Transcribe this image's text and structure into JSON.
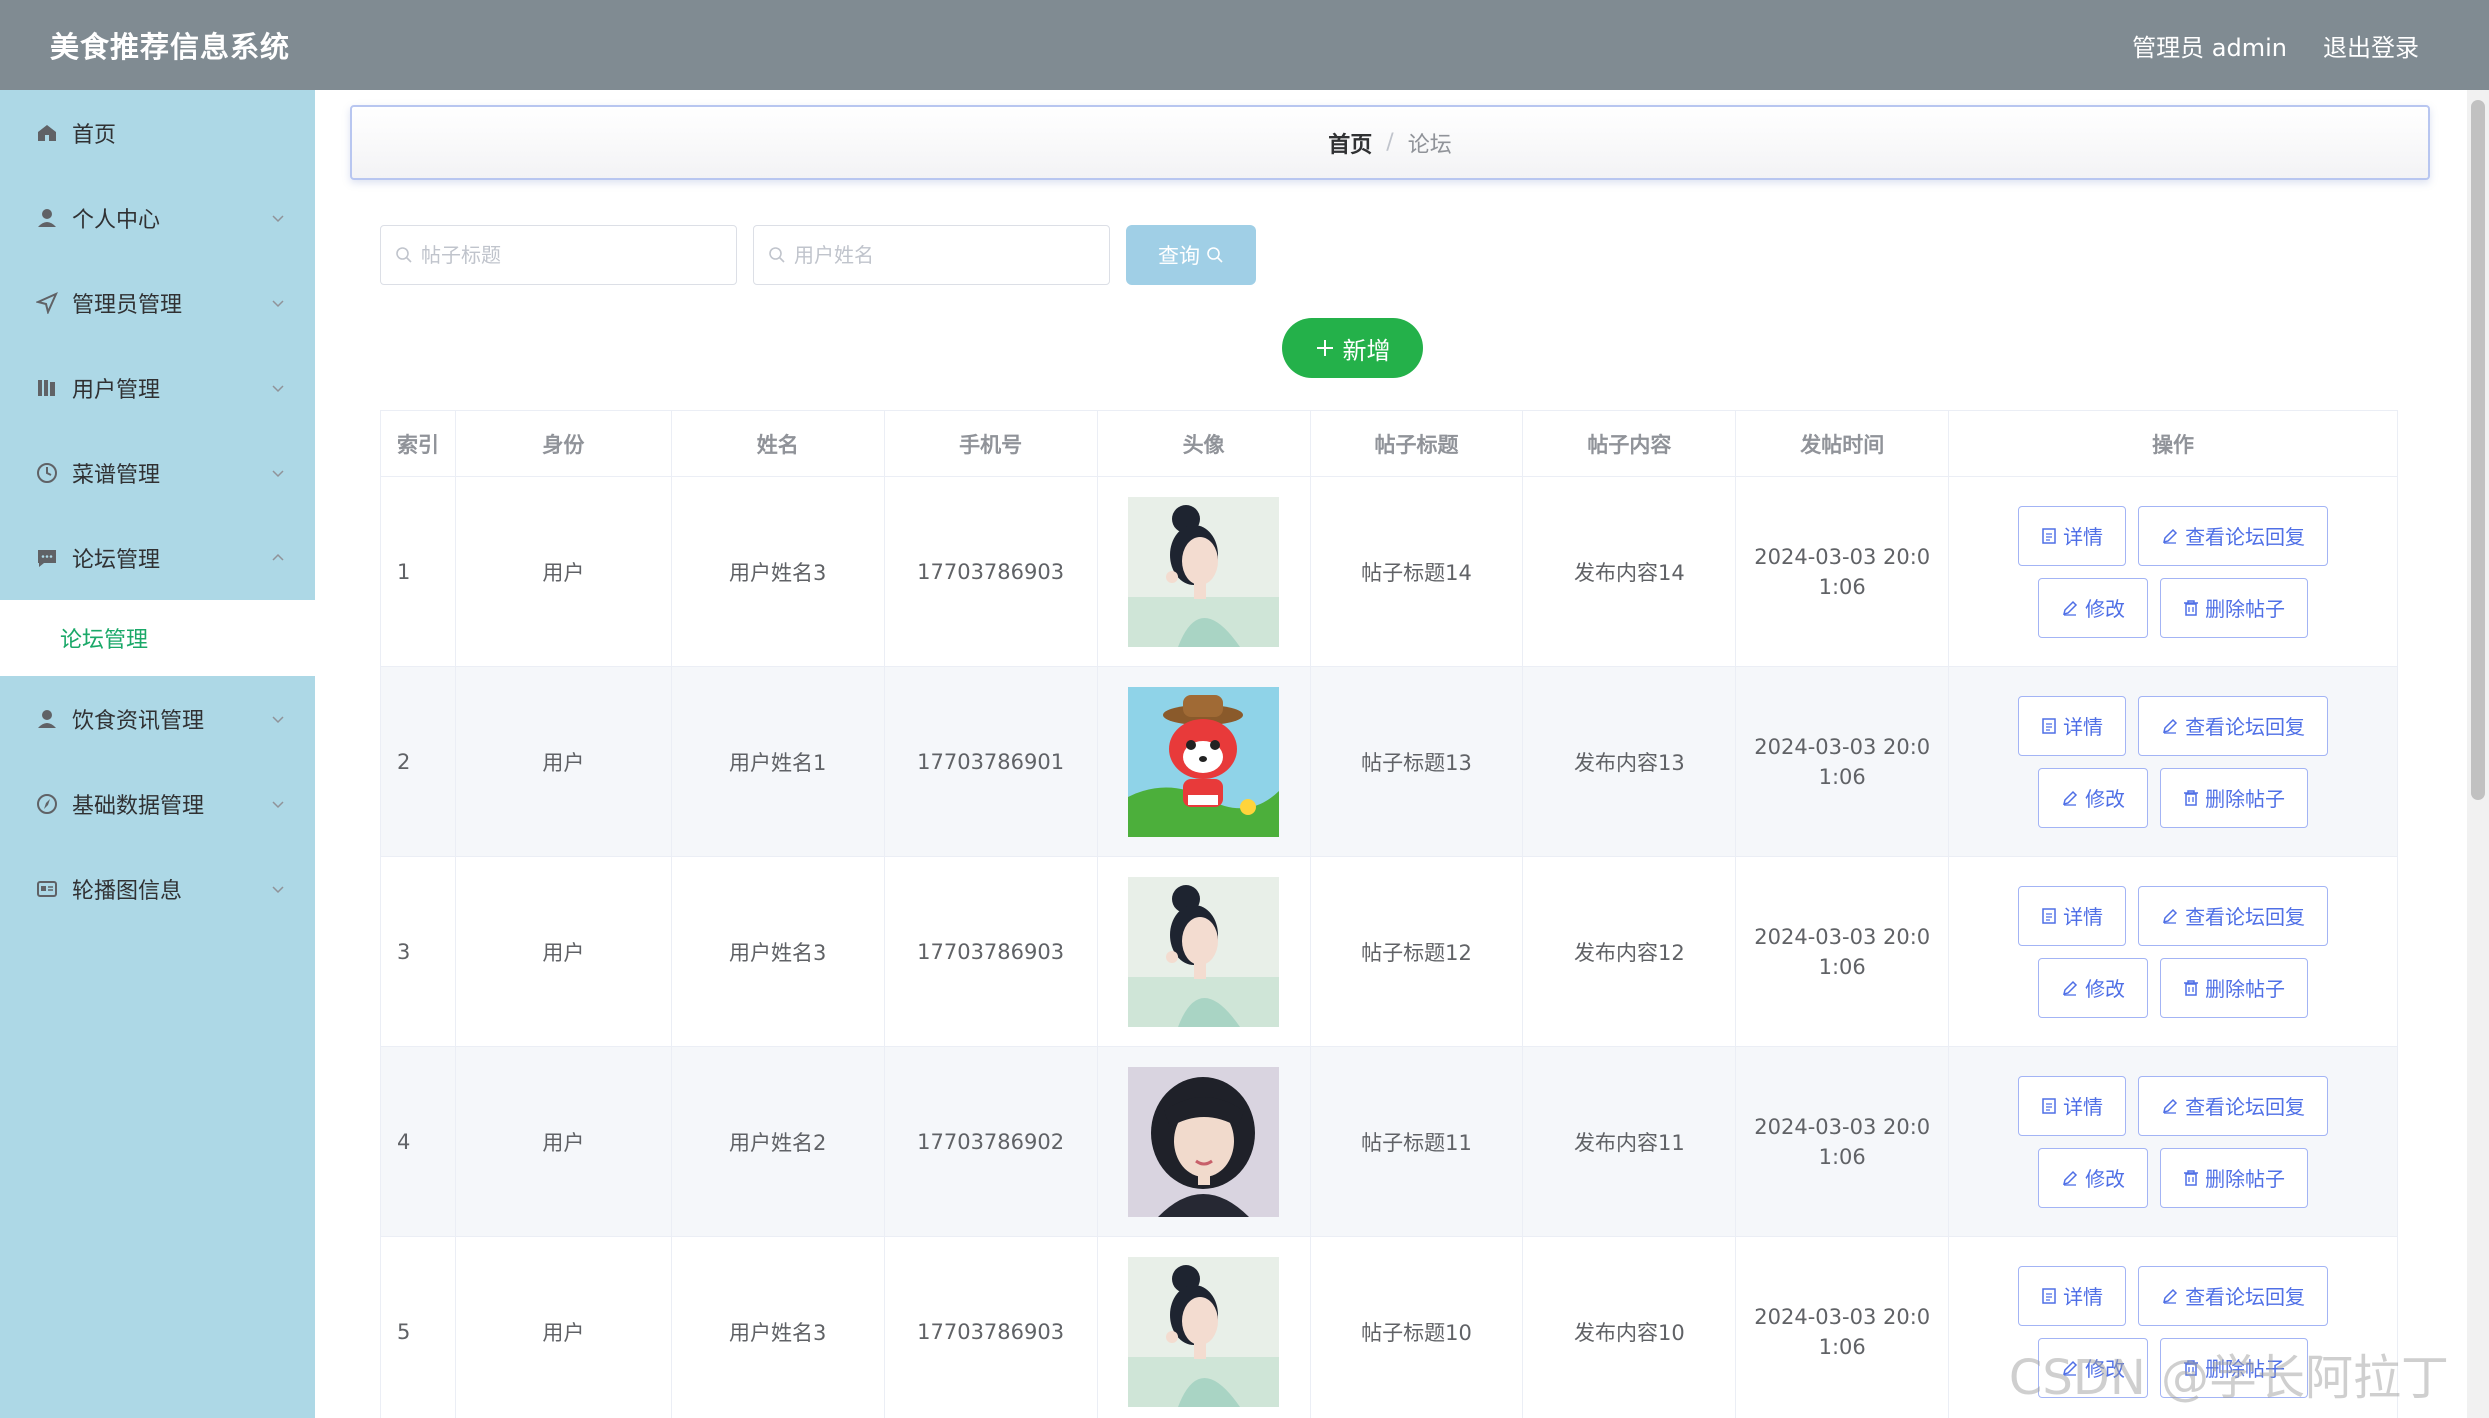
{
  "header": {
    "title": "美食推荐信息系统",
    "user_label": "管理员 admin",
    "logout": "退出登录"
  },
  "sidebar": {
    "items": [
      {
        "label": "首页"
      },
      {
        "label": "个人中心"
      },
      {
        "label": "管理员管理"
      },
      {
        "label": "用户管理"
      },
      {
        "label": "菜谱管理"
      },
      {
        "label": "论坛管理"
      },
      {
        "label": "饮食资讯管理"
      },
      {
        "label": "基础数据管理"
      },
      {
        "label": "轮播图信息"
      }
    ],
    "submenu": {
      "label": "论坛管理"
    }
  },
  "breadcrumb": {
    "home": "首页",
    "sep": "/",
    "current": "论坛"
  },
  "search": {
    "title_placeholder": "帖子标题",
    "name_placeholder": "用户姓名",
    "query_label": "查询"
  },
  "add_label": "新增",
  "table": {
    "headers": [
      "索引",
      "身份",
      "姓名",
      "手机号",
      "头像",
      "帖子标题",
      "帖子内容",
      "发帖时间",
      "操作"
    ],
    "rows": [
      {
        "idx": "1",
        "role": "用户",
        "name": "用户姓名3",
        "phone": "17703786903",
        "title": "帖子标题14",
        "content": "发布内容14",
        "time1": "2024-03-03 20:0",
        "time2": "1:06"
      },
      {
        "idx": "2",
        "role": "用户",
        "name": "用户姓名1",
        "phone": "17703786901",
        "title": "帖子标题13",
        "content": "发布内容13",
        "time1": "2024-03-03 20:0",
        "time2": "1:06"
      },
      {
        "idx": "3",
        "role": "用户",
        "name": "用户姓名3",
        "phone": "17703786903",
        "title": "帖子标题12",
        "content": "发布内容12",
        "time1": "2024-03-03 20:0",
        "time2": "1:06"
      },
      {
        "idx": "4",
        "role": "用户",
        "name": "用户姓名2",
        "phone": "17703786902",
        "title": "帖子标题11",
        "content": "发布内容11",
        "time1": "2024-03-03 20:0",
        "time2": "1:06"
      },
      {
        "idx": "5",
        "role": "用户",
        "name": "用户姓名3",
        "phone": "17703786903",
        "title": "帖子标题10",
        "content": "发布内容10",
        "time1": "2024-03-03 20:0",
        "time2": "1:06"
      }
    ],
    "actions": {
      "detail": "详情",
      "replies": "查看论坛回复",
      "edit": "修改",
      "delete": "删除帖子"
    }
  },
  "watermark": "CSDN @学长阿拉丁"
}
